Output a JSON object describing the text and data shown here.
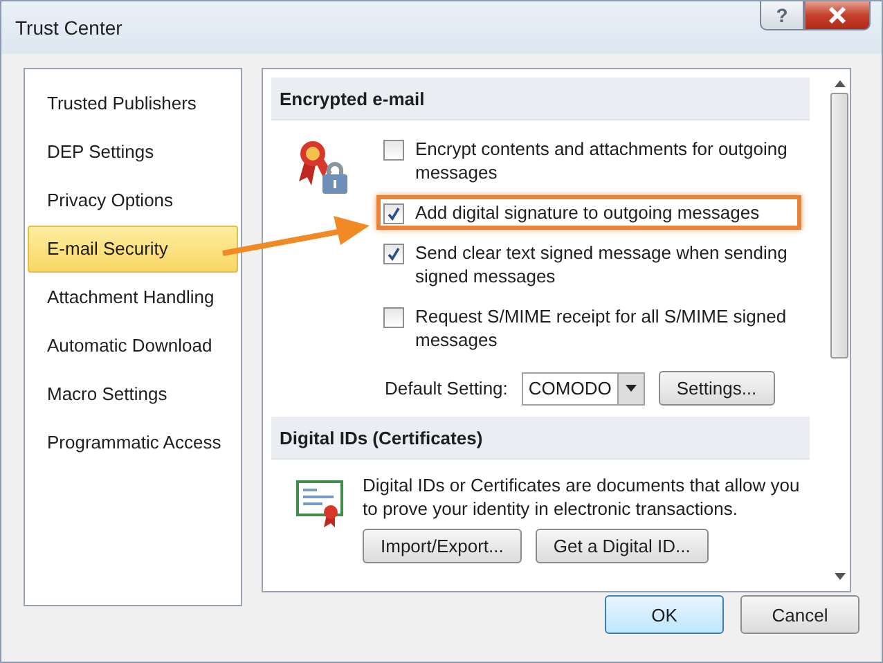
{
  "window": {
    "title": "Trust Center",
    "help_button": "?"
  },
  "sidebar": {
    "items": [
      {
        "label": "Trusted Publishers",
        "selected": false
      },
      {
        "label": "DEP Settings",
        "selected": false
      },
      {
        "label": "Privacy Options",
        "selected": false
      },
      {
        "label": "E-mail Security",
        "selected": true
      },
      {
        "label": "Attachment Handling",
        "selected": false
      },
      {
        "label": "Automatic Download",
        "selected": false
      },
      {
        "label": "Macro Settings",
        "selected": false
      },
      {
        "label": "Programmatic Access",
        "selected": false
      }
    ]
  },
  "encrypted_email": {
    "heading": "Encrypted e-mail",
    "options": [
      {
        "label": "Encrypt contents and attachments for outgoing messages",
        "checked": false,
        "highlighted": false
      },
      {
        "label": "Add digital signature to outgoing messages",
        "checked": true,
        "highlighted": true
      },
      {
        "label": "Send clear text signed message when sending signed messages",
        "checked": true,
        "highlighted": false
      },
      {
        "label": "Request S/MIME receipt for all S/MIME signed messages",
        "checked": false,
        "highlighted": false
      }
    ],
    "default_setting": {
      "label": "Default Setting:",
      "value": "COMODO"
    },
    "settings_button": "Settings..."
  },
  "digital_ids": {
    "heading": "Digital IDs (Certificates)",
    "description": "Digital IDs or Certificates are documents that allow you to prove your identity in electronic transactions.",
    "buttons": [
      "Import/Export...",
      "Get a Digital ID..."
    ]
  },
  "buttons": [
    {
      "label": "OK",
      "default": true
    },
    {
      "label": "Cancel",
      "default": false
    }
  ]
}
